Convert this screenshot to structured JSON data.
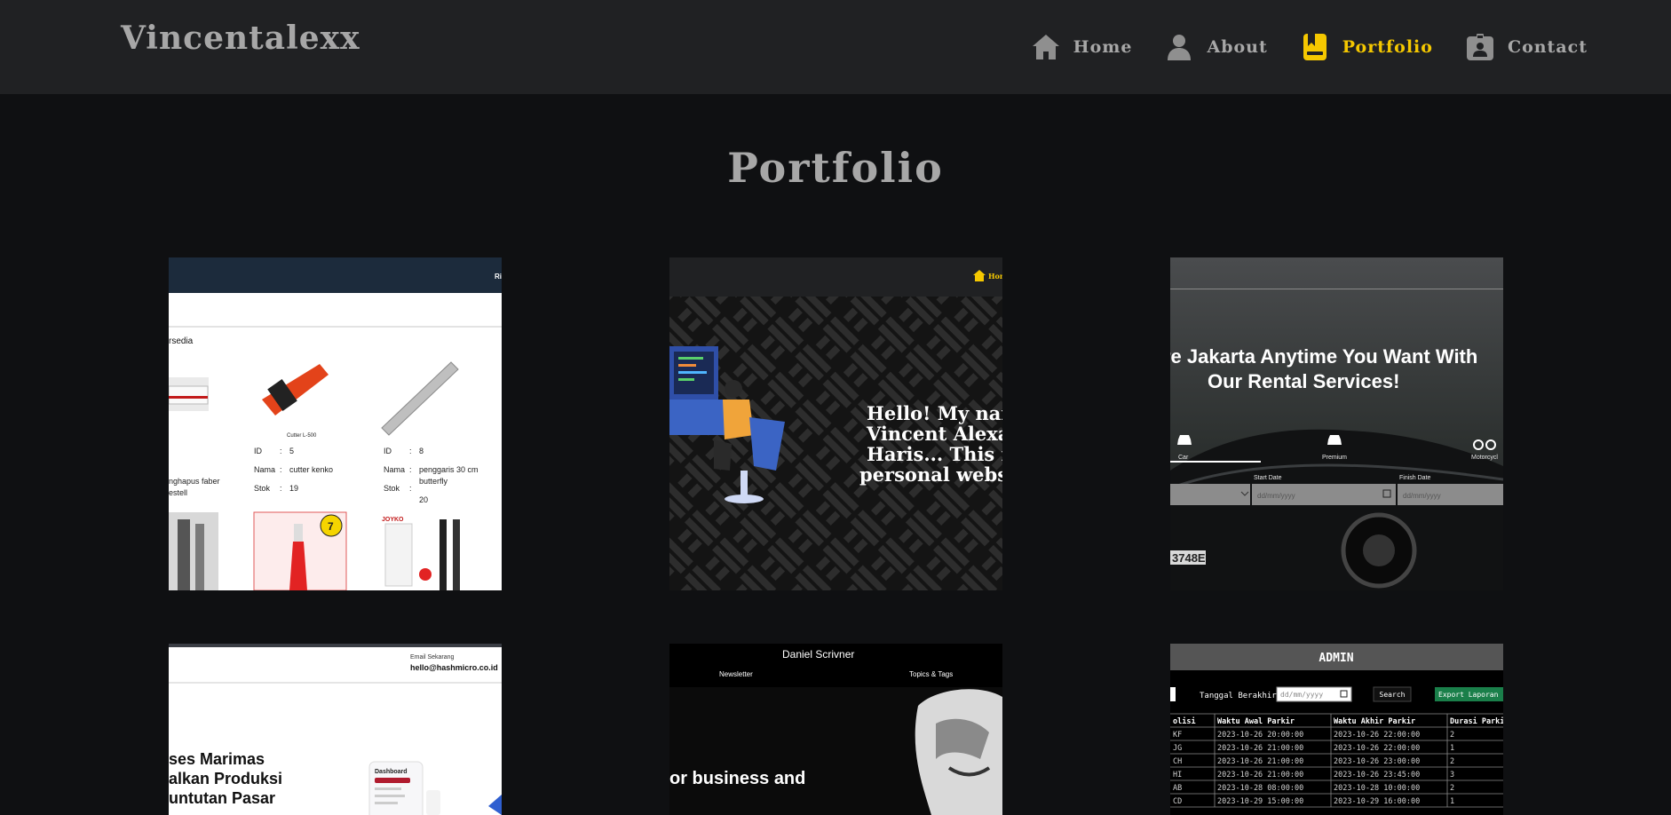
{
  "header": {
    "brand": "Vincentalexx",
    "nav": [
      {
        "label": "Home",
        "icon": "home-icon",
        "active": false
      },
      {
        "label": "About",
        "icon": "user-icon",
        "active": false
      },
      {
        "label": "Portfolio",
        "icon": "portfolio-icon",
        "active": true
      },
      {
        "label": "Contact",
        "icon": "contact-icon",
        "active": false
      }
    ],
    "active_color": "#f5c800"
  },
  "page": {
    "title": "Portfolio"
  },
  "portfolio": {
    "card1": {
      "nav_fragment": "Ri",
      "heading_fragment": "rsedia",
      "product_a_caption": "Cutter L-500",
      "product_a_id_label": "ID",
      "product_a_id": "5",
      "product_a_name_label": "Nama",
      "product_a_name": "cutter kenko",
      "product_a_stock_label": "Stok",
      "product_a_stock": "19",
      "product_b_id_label": "ID",
      "product_b_id": "8",
      "product_b_name_label": "Nama",
      "product_b_name_1": "penggaris 30 cm",
      "product_b_name_2": "butterfly",
      "product_b_stock_label": "Stok",
      "product_b_stock": "20",
      "left_fragment_1": "nghapus faber",
      "left_fragment_2": "estell",
      "badge": "7",
      "brand_fragment": "JOYKO"
    },
    "card2": {
      "nav_fragment": "Hom",
      "greeting_1": "Hello! My nam",
      "greeting_2": "Vincent Alexan",
      "greeting_3": "Haris... This is",
      "greeting_4": "personal websit"
    },
    "card3": {
      "headline_1": "re Jakarta Anytime You Want With",
      "headline_2": "Our Rental Services!",
      "tab_car": "Car",
      "tab_premium": "Premium",
      "tab_motor": "Motorcycl",
      "start_label": "Start Date",
      "finish_label": "Finish Date",
      "date_placeholder": "dd/mm/yyyy",
      "plate": "3748E"
    },
    "card4": {
      "contact_label": "Email Sekarang",
      "contact_email": "hello@hashmicro.co.id",
      "headline_1": "ses Marimas",
      "headline_2": "alkan Produksi",
      "headline_3": "untutan Pasar",
      "dash_label": "Dashboard"
    },
    "card5": {
      "site_title": "Daniel Scrivner",
      "nav_1": "Newsletter",
      "nav_2": "Topics & Tags",
      "headline": "or business and"
    },
    "card6": {
      "title": "ADMIN",
      "filter_label": "Tanggal Berakhir",
      "date_placeholder": "dd/mm/yyyy",
      "search_btn": "Search",
      "export_btn": "Export Laporan",
      "columns": [
        "olisi",
        "Waktu Awal Parkir",
        "Waktu Akhir Parkir",
        "Durasi Parki"
      ],
      "rows": [
        [
          "KF",
          "2023-10-26 20:00:00",
          "2023-10-26 22:00:00",
          "2"
        ],
        [
          "JG",
          "2023-10-26 21:00:00",
          "2023-10-26 22:00:00",
          "1"
        ],
        [
          "CH",
          "2023-10-26 21:00:00",
          "2023-10-26 23:00:00",
          "2"
        ],
        [
          "HI",
          "2023-10-26 21:00:00",
          "2023-10-26 23:45:00",
          "3"
        ],
        [
          "AB",
          "2023-10-28 08:00:00",
          "2023-10-28 10:00:00",
          "2"
        ],
        [
          "CD",
          "2023-10-29 15:00:00",
          "2023-10-29 16:00:00",
          "1"
        ]
      ]
    }
  }
}
